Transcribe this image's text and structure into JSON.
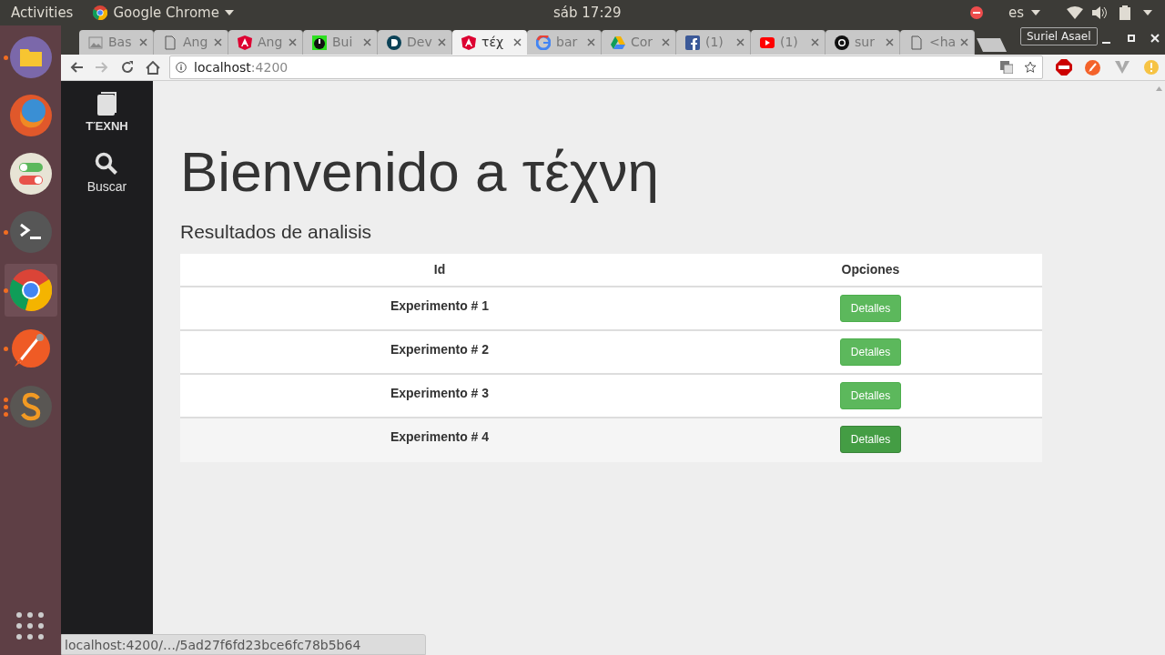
{
  "top_bar": {
    "activities": "Activities",
    "app_name": "Google Chrome",
    "clock": "sáb 17:29",
    "language": "es"
  },
  "launcher": [
    {
      "kind": "files",
      "running": true,
      "selected": false
    },
    {
      "kind": "firefox",
      "running": false,
      "selected": false
    },
    {
      "kind": "settings",
      "running": false,
      "selected": false
    },
    {
      "kind": "terminal",
      "running": true,
      "selected": false
    },
    {
      "kind": "chrome",
      "running": true,
      "selected": true
    },
    {
      "kind": "postman",
      "running": true,
      "selected": false
    },
    {
      "kind": "sublime",
      "running": true,
      "multiple_windows": true,
      "selected": false
    }
  ],
  "tabs": [
    {
      "kind": "image",
      "label": "Bas",
      "selected": false
    },
    {
      "kind": "document",
      "label": "Ang",
      "selected": false
    },
    {
      "kind": "angular",
      "label": "Ang",
      "selected": false
    },
    {
      "kind": "build",
      "label": "Bui",
      "selected": false
    },
    {
      "kind": "dev",
      "label": "Dev",
      "selected": false
    },
    {
      "kind": "angular",
      "label": "τέχ",
      "selected": true
    },
    {
      "kind": "google",
      "label": "bar",
      "selected": false
    },
    {
      "kind": "drive",
      "label": "Cor",
      "selected": false
    },
    {
      "kind": "facebook",
      "label": "(1)",
      "selected": false
    },
    {
      "kind": "youtube",
      "label": "(1)",
      "selected": false
    },
    {
      "kind": "github",
      "label": "sur",
      "selected": false
    },
    {
      "kind": "document",
      "label": "<ha",
      "selected": false
    }
  ],
  "profile": "Suriel Asael",
  "address": {
    "host": "localhost",
    "port": ":4200"
  },
  "app_sidebar": [
    {
      "kind": "book",
      "label": "ΤΈΧΝΗ"
    },
    {
      "kind": "search",
      "label": "Buscar"
    }
  ],
  "heading": "Bienvenido a τέχνη",
  "subheading": "Resultados de analisis",
  "table": {
    "columns": [
      "Id",
      "Opciones"
    ],
    "rows": [
      {
        "id": "Experimento # 1",
        "action": "Detalles",
        "hovered": false
      },
      {
        "id": "Experimento # 2",
        "action": "Detalles",
        "hovered": false
      },
      {
        "id": "Experimento # 3",
        "action": "Detalles",
        "hovered": false
      },
      {
        "id": "Experimento # 4",
        "action": "Detalles",
        "hovered": true
      }
    ]
  },
  "status_url": "localhost:4200/…/5ad27f6fd23bce6fc78b5b64"
}
